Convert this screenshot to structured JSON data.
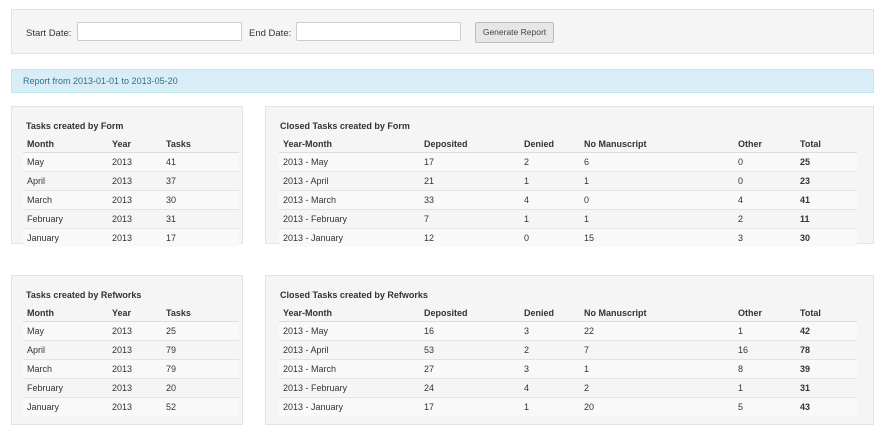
{
  "filters": {
    "start_label": "Start Date:",
    "end_label": "End Date:",
    "start_value": "",
    "end_value": "",
    "button_label": "Generate Report"
  },
  "alert": {
    "text": "Report from 2013-01-01 to 2013-05-20"
  },
  "form_tasks": {
    "title": "Tasks created by Form",
    "headers": [
      "Month",
      "Year",
      "Tasks"
    ],
    "rows": [
      [
        "May",
        "2013",
        "41"
      ],
      [
        "April",
        "2013",
        "37"
      ],
      [
        "March",
        "2013",
        "30"
      ],
      [
        "February",
        "2013",
        "31"
      ],
      [
        "January",
        "2013",
        "17"
      ]
    ]
  },
  "form_closed": {
    "title": "Closed Tasks created by Form",
    "headers": [
      "Year-Month",
      "Deposited",
      "Denied",
      "No Manuscript",
      "Other",
      "Total"
    ],
    "rows": [
      [
        "2013 - May",
        "17",
        "2",
        "6",
        "0",
        "25"
      ],
      [
        "2013 - April",
        "21",
        "1",
        "1",
        "0",
        "23"
      ],
      [
        "2013 - March",
        "33",
        "4",
        "0",
        "4",
        "41"
      ],
      [
        "2013 - February",
        "7",
        "1",
        "1",
        "2",
        "11"
      ],
      [
        "2013 - January",
        "12",
        "0",
        "15",
        "3",
        "30"
      ]
    ]
  },
  "refworks_tasks": {
    "title": "Tasks created by Refworks",
    "headers": [
      "Month",
      "Year",
      "Tasks"
    ],
    "rows": [
      [
        "May",
        "2013",
        "25"
      ],
      [
        "April",
        "2013",
        "79"
      ],
      [
        "March",
        "2013",
        "79"
      ],
      [
        "February",
        "2013",
        "20"
      ],
      [
        "January",
        "2013",
        "52"
      ]
    ]
  },
  "refworks_closed": {
    "title": "Closed Tasks created by Refworks",
    "headers": [
      "Year-Month",
      "Deposited",
      "Denied",
      "No Manuscript",
      "Other",
      "Total"
    ],
    "rows": [
      [
        "2013 - May",
        "16",
        "3",
        "22",
        "1",
        "42"
      ],
      [
        "2013 - April",
        "53",
        "2",
        "7",
        "16",
        "78"
      ],
      [
        "2013 - March",
        "27",
        "3",
        "1",
        "8",
        "39"
      ],
      [
        "2013 - February",
        "24",
        "4",
        "2",
        "1",
        "31"
      ],
      [
        "2013 - January",
        "17",
        "1",
        "20",
        "5",
        "43"
      ]
    ]
  }
}
